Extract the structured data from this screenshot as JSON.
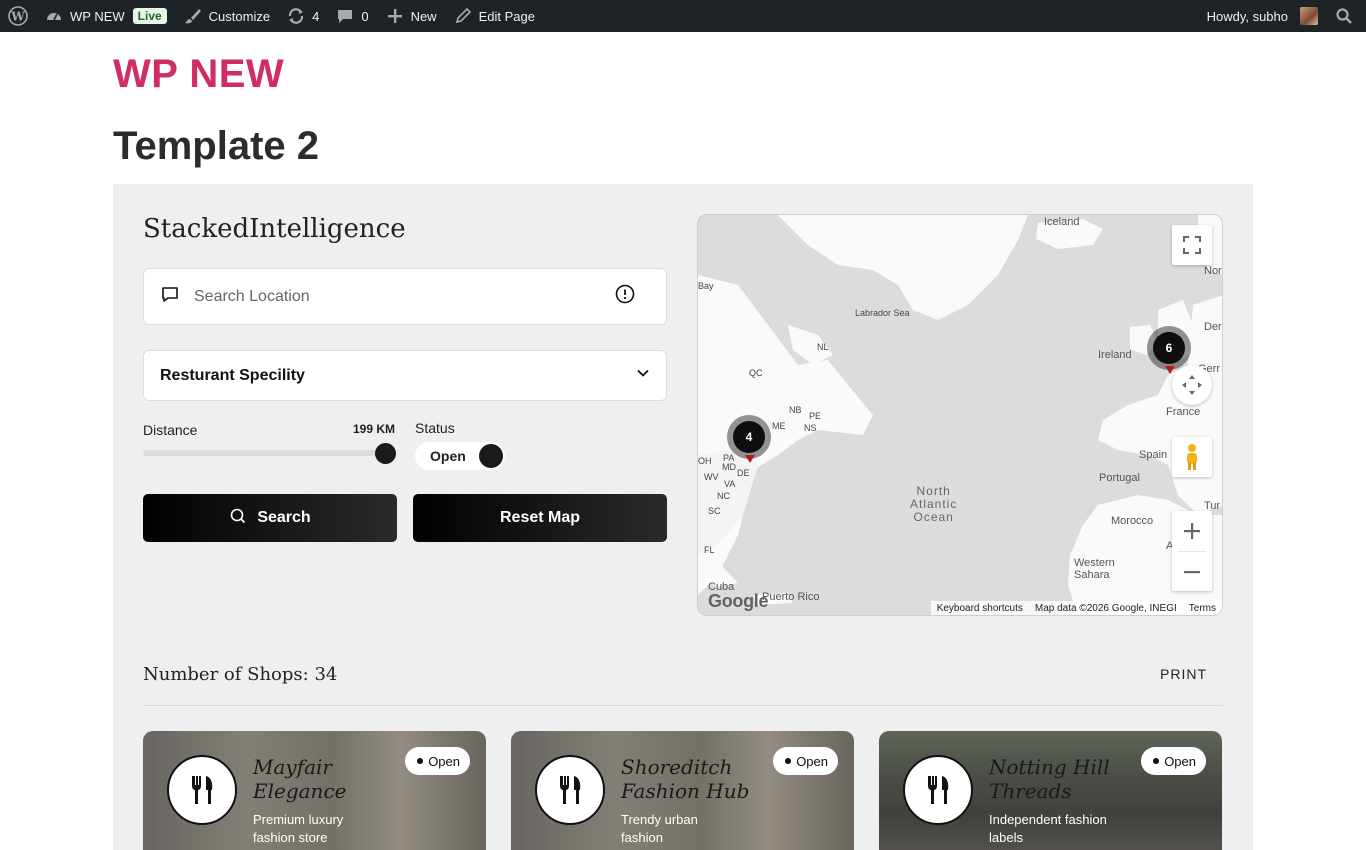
{
  "adminbar": {
    "site_name": "WP NEW",
    "live_badge": "Live",
    "customize": "Customize",
    "updates_count": "4",
    "comments_count": "0",
    "new_label": "New",
    "edit_page": "Edit Page",
    "greeting": "Howdy, subho"
  },
  "site": {
    "title": "WP NEW",
    "page_title": "Template 2"
  },
  "finder": {
    "brand": "StackedIntelligence",
    "search_placeholder": "Search Location",
    "specialty_select": "Resturant Specility",
    "distance_label": "Distance",
    "distance_value": "199 KM",
    "distance_fraction": 0.95,
    "status_label": "Status",
    "status_value": "Open",
    "search_button": "Search",
    "reset_button": "Reset Map"
  },
  "map": {
    "labels": {
      "iceland": "Iceland",
      "bay": "Bay",
      "labrador_sea": "Labrador Sea",
      "nl": "NL",
      "qc": "QC",
      "nb": "NB",
      "pe": "PE",
      "me": "ME",
      "ns": "NS",
      "oh": "OH",
      "pa": "PA",
      "md": "MD",
      "de": "DE",
      "wv": "WV",
      "va": "VA",
      "nc": "NC",
      "sc": "SC",
      "fl": "FL",
      "cuba": "Cuba",
      "puerto_rico": "Puerto Rico",
      "ireland": "Ireland",
      "france": "France",
      "spain": "Spain",
      "portugal": "Portugal",
      "morocco": "Morocco",
      "western_sahara": "Western\nSahara",
      "ocean": "North\nAtlantic\nOcean",
      "nor": "Nor",
      "den": "Der",
      "ger": "Gerr",
      "tur": "Tur",
      "a": "A"
    },
    "clusters": [
      {
        "count": "4"
      },
      {
        "count": "6"
      }
    ],
    "google": "Google",
    "footer_shortcuts": "Keyboard shortcuts",
    "footer_data": "Map data ©2026 Google, INEGI",
    "footer_terms": "Terms"
  },
  "results": {
    "count_label": "Number of Shops: 34",
    "print": "PRINT",
    "cards": [
      {
        "title": "Mayfair Elegance",
        "desc": "Premium luxury fashion store",
        "status": "Open"
      },
      {
        "title": "Shoreditch Fashion Hub",
        "desc": "Trendy urban fashion",
        "status": "Open"
      },
      {
        "title": "Notting Hill Threads",
        "desc": "Independent fashion labels",
        "status": "Open"
      }
    ]
  },
  "colors": {
    "adminbar": "#1d2327",
    "site_title": "#cf2e63",
    "panel": "#efefef",
    "button": "#000000"
  },
  "icons": {
    "wp": "wordpress-icon",
    "dashboard": "dashboard-icon",
    "customize": "brush-icon",
    "updates": "refresh-icon",
    "comments": "comment-icon",
    "new": "plus-icon",
    "edit": "pencil-icon",
    "search": "search-icon",
    "restaurant": "fork-knife-icon"
  }
}
